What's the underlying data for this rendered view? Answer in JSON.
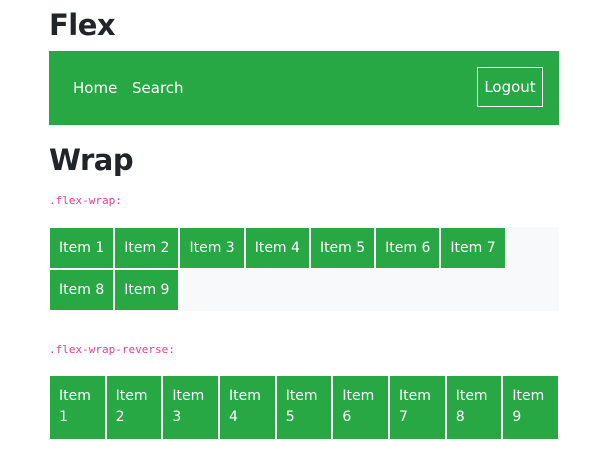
{
  "page": {
    "title": "Flex",
    "section_title": "Wrap"
  },
  "navbar": {
    "links": [
      "Home",
      "Search"
    ],
    "logout_label": "Logout",
    "background": "#28a745"
  },
  "demo1": {
    "code": ".flex-wrap:",
    "items": [
      "Item 1",
      "Item 2",
      "Item 3",
      "Item 4",
      "Item 5",
      "Item 6",
      "Item 7",
      "Item 8",
      "Item 9"
    ]
  },
  "demo2": {
    "code": ".flex-wrap-reverse:",
    "items": [
      "Item 1",
      "Item 2",
      "Item 3",
      "Item 4",
      "Item 5",
      "Item 6",
      "Item 7",
      "Item 8",
      "Item 9"
    ]
  }
}
